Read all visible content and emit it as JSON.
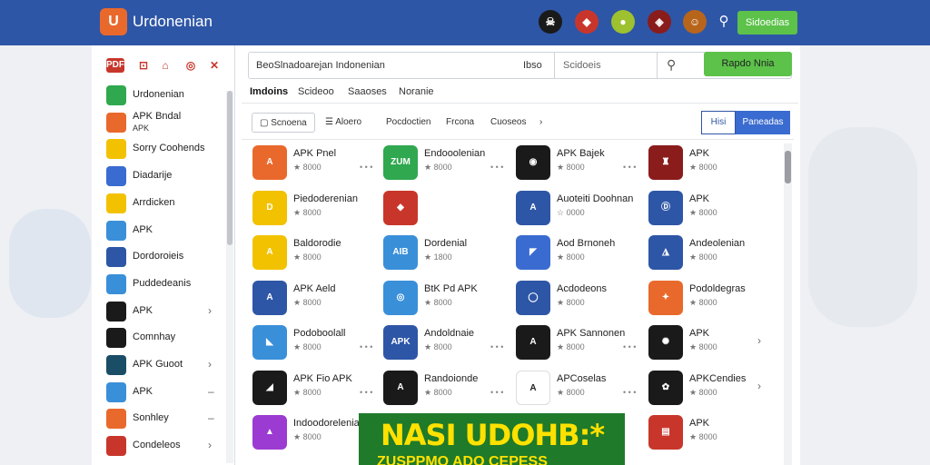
{
  "header": {
    "logo_glyph": "U",
    "brand": "Urdonenian",
    "icons": [
      {
        "name": "pirate-badge-icon",
        "color": "#1a1a1a",
        "glyph": "☠"
      },
      {
        "name": "robot-icon",
        "color": "#c8362b",
        "glyph": "◆"
      },
      {
        "name": "fruit-icon",
        "color": "#9dc12f",
        "glyph": "●"
      },
      {
        "name": "shield-badge-icon",
        "color": "#8a1c1c",
        "glyph": "◈"
      },
      {
        "name": "avatar-icon",
        "color": "#b8651c",
        "glyph": "☺"
      }
    ],
    "search_glyph": "⚲",
    "button_label": "Sidoedias"
  },
  "sidebar": {
    "tabs": [
      "PDF",
      "⊡",
      "⌂",
      "◎",
      "✕"
    ],
    "items": [
      {
        "label": "Urdonenian",
        "color": "#2fa84f",
        "chevron": ""
      },
      {
        "label": "APK Bndal",
        "label2": "APK",
        "color": "#e9692c",
        "chevron": ""
      },
      {
        "label": "Sorry Coohends",
        "color": "#f2c200",
        "chevron": ""
      },
      {
        "label": "Diadarije",
        "color": "#3a6bd0",
        "chevron": ""
      },
      {
        "label": "Arrdicken",
        "color": "#f2c200",
        "chevron": ""
      },
      {
        "label": "APK",
        "color": "#3a8fd9",
        "chevron": ""
      },
      {
        "label": "Dordoroieis",
        "color": "#2e56a6",
        "chevron": ""
      },
      {
        "label": "Puddedeanis",
        "color": "#3a8fd9",
        "chevron": ""
      },
      {
        "label": "APK",
        "color": "#1a1a1a",
        "chevron": "›"
      },
      {
        "label": "Comnhay",
        "color": "#1a1a1a",
        "chevron": ""
      },
      {
        "label": "APK Guoot",
        "color": "#1a4d66",
        "chevron": "›"
      },
      {
        "label": "APK",
        "color": "#3a8fd9",
        "chevron": "–"
      },
      {
        "label": "Sonhley",
        "color": "#e9692c",
        "chevron": "–"
      },
      {
        "label": "Condeleos",
        "color": "#c8362b",
        "chevron": "›"
      }
    ]
  },
  "main": {
    "url_text": "BeoSlnadoarejan Indonenian",
    "url_lang": "Ibso",
    "search_placeholder": "Scidoeis",
    "search_glyph": "⚲",
    "button_label": "Rapdo Nnia",
    "tabs": [
      "Imdoins",
      "Scideoo",
      "Saaoses",
      "Noranie"
    ],
    "toolbar": {
      "filter_label": "Scnoena",
      "sort_label": "Aloero",
      "category_label": "Pocdoctien",
      "platform_label": "Frcona",
      "other_label": "Cuoseos",
      "chevron": "›",
      "view_a": "Hisi",
      "view_b": "Paneadas"
    },
    "apps": [
      [
        {
          "title": "APK Pnel",
          "rating": "★ 8000",
          "color": "#e9692c",
          "glyph": "A",
          "dots": "• • •",
          "chev": ""
        },
        {
          "title": "Endooolenian",
          "rating": "★ 8000",
          "color": "#2fa84f",
          "glyph": "ZUM",
          "dots": "• • •",
          "chev": ""
        },
        {
          "title": "APK Bajek",
          "rating": "★ 8000",
          "color": "#1a1a1a",
          "glyph": "◉",
          "dots": "• • •",
          "chev": ""
        },
        {
          "title": "APK",
          "rating": "★ 8000",
          "color": "#8a1c1c",
          "glyph": "♜",
          "dots": "",
          "chev": ""
        }
      ],
      [
        {
          "title": "Piedoderenian",
          "rating": "★ 8000",
          "color": "#f2c200",
          "glyph": "D",
          "dots": "",
          "chev": ""
        },
        {
          "title": "",
          "rating": "",
          "color": "#c8362b",
          "glyph": "◆",
          "dots": "",
          "chev": ""
        },
        {
          "title": "Auoteiti Doohnan",
          "rating": "☆ 0000",
          "color": "#2e56a6",
          "glyph": "A",
          "dots": "",
          "chev": ""
        },
        {
          "title": "APK",
          "rating": "★ 8000",
          "color": "#2e56a6",
          "glyph": "Ⓓ",
          "dots": "",
          "chev": ""
        }
      ],
      [
        {
          "title": "Baldorodie",
          "rating": "★ 8000",
          "color": "#f2c200",
          "glyph": "A",
          "dots": "",
          "chev": ""
        },
        {
          "title": "Dordenial",
          "rating": "★ 1800",
          "color": "#3a8fd9",
          "glyph": "AIB",
          "dots": "",
          "chev": ""
        },
        {
          "title": "Aod Brnoneh",
          "rating": "★ 8000",
          "color": "#3a6bd0",
          "glyph": "◤",
          "dots": "",
          "chev": ""
        },
        {
          "title": "Andeolenian",
          "rating": "★ 8000",
          "color": "#2e56a6",
          "glyph": "◮",
          "dots": "",
          "chev": ""
        }
      ],
      [
        {
          "title": "APK Aeld",
          "rating": "★ 8000",
          "color": "#2e56a6",
          "glyph": "A",
          "dots": "",
          "chev": ""
        },
        {
          "title": "BtK Pd APK",
          "rating": "★ 8000",
          "color": "#3a8fd9",
          "glyph": "◎",
          "dots": "",
          "chev": ""
        },
        {
          "title": "Acdodeons",
          "rating": "★ 8000",
          "color": "#2e56a6",
          "glyph": "◯",
          "dots": "",
          "chev": ""
        },
        {
          "title": "Podoldegras",
          "rating": "★ 8000",
          "color": "#e9692c",
          "glyph": "✦",
          "dots": "",
          "chev": ""
        }
      ],
      [
        {
          "title": "Podoboolall",
          "rating": "★ 8000",
          "color": "#3a8fd9",
          "glyph": "◣",
          "dots": "• • •",
          "chev": ""
        },
        {
          "title": "Andoldnaie",
          "rating": "★ 8000",
          "color": "#2e56a6",
          "glyph": "APK",
          "dots": "• • •",
          "chev": ""
        },
        {
          "title": "APK Sannonen",
          "rating": "★ 8000",
          "color": "#1a1a1a",
          "glyph": "A",
          "dots": "• • •",
          "chev": ""
        },
        {
          "title": "APK",
          "rating": "★ 8000",
          "color": "#1a1a1a",
          "glyph": "✺",
          "dots": "",
          "chev": "›"
        }
      ],
      [
        {
          "title": "APK Fio APK",
          "rating": "★ 8000",
          "color": "#1a1a1a",
          "glyph": "◢",
          "dots": "• • •",
          "chev": ""
        },
        {
          "title": "Randoionde",
          "rating": "★ 8000",
          "color": "#1a1a1a",
          "glyph": "A",
          "dots": "• • •",
          "chev": ""
        },
        {
          "title": "APCoselas",
          "rating": "★ 8000",
          "color": "#ffffff",
          "glyph": "A",
          "dots": "• • •",
          "chev": ""
        },
        {
          "title": "APKCendies",
          "rating": "★ 8000",
          "color": "#1a1a1a",
          "glyph": "✿",
          "dots": "",
          "chev": "›"
        }
      ],
      [
        {
          "title": "Indoodorelenian",
          "rating": "★ 8000",
          "color": "#9b3bd1",
          "glyph": "▲",
          "dots": "• • •",
          "chev": ""
        },
        {
          "title": "",
          "rating": "",
          "color": "#ffffff",
          "glyph": "",
          "dots": "",
          "chev": ""
        },
        {
          "title": "",
          "rating": "",
          "color": "#ffffff",
          "glyph": "",
          "dots": "",
          "chev": ""
        },
        {
          "title": "APK",
          "rating": "★ 8000",
          "color": "#c8362b",
          "glyph": "▤",
          "dots": "",
          "chev": ""
        }
      ]
    ]
  },
  "banner": {
    "title": "NASI UDOHB:*",
    "subtitle": "ZUSPPMO ADO CEPESS"
  }
}
